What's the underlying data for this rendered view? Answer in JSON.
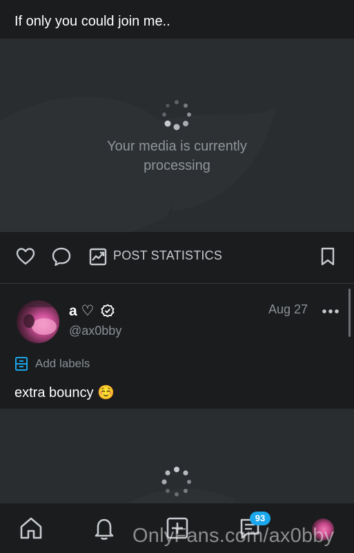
{
  "post1": {
    "caption": "If only you could join me..",
    "media_status": "Your media is currently processing",
    "media_status_line1": "Your media is currently",
    "media_status_line2": "processing",
    "actions": {
      "like_icon": "heart-icon",
      "comment_icon": "comment-icon",
      "stats_icon": "chart-icon",
      "stats_label": "POST STATISTICS",
      "bookmark_icon": "bookmark-icon"
    }
  },
  "post2": {
    "author_name": "a ♡",
    "verified_icon": "verified-icon",
    "handle": "@ax0bby",
    "date": "Aug 27",
    "more_icon": "more-icon",
    "labels_icon": "label-icon",
    "labels_text": "Add labels",
    "text": "extra bouncy ☺️"
  },
  "navbar": {
    "items": [
      {
        "icon": "home-icon"
      },
      {
        "icon": "bell-icon"
      },
      {
        "icon": "add-post-icon"
      },
      {
        "icon": "messages-icon",
        "badge": "93"
      },
      {
        "icon": "profile-avatar"
      }
    ]
  },
  "watermark": "OnlyFans.com/ax0bby",
  "colors": {
    "background": "#1b1c1e",
    "media_placeholder": "#2a2d30",
    "accent": "#1aa7ec",
    "muted_text": "#8a9096"
  }
}
